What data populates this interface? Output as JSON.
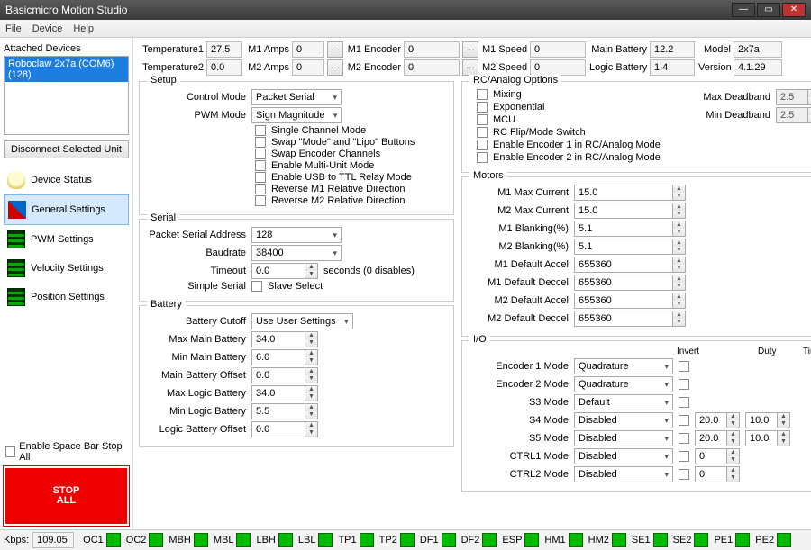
{
  "window": {
    "title": "Basicmicro Motion Studio"
  },
  "menu": {
    "file": "File",
    "device": "Device",
    "help": "Help"
  },
  "sidebar": {
    "attached": "Attached Devices",
    "device": "Roboclaw 2x7a (COM6) (128)",
    "disconnect": "Disconnect Selected Unit",
    "nav": {
      "status": "Device Status",
      "general": "General Settings",
      "pwm": "PWM Settings",
      "velocity": "Velocity Settings",
      "position": "Position Settings"
    },
    "stopchk": "Enable Space Bar Stop All",
    "stop1": "STOP",
    "stop2": "ALL"
  },
  "readouts": {
    "temp1_lbl": "Temperature1",
    "temp1": "27.5",
    "temp2_lbl": "Temperature2",
    "temp2": "0.0",
    "m1a_lbl": "M1 Amps",
    "m1a": "0",
    "m2a_lbl": "M2 Amps",
    "m2a": "0",
    "m1e_lbl": "M1 Encoder",
    "m1e": "0",
    "m2e_lbl": "M2 Encoder",
    "m2e": "0",
    "m1s_lbl": "M1 Speed",
    "m1s": "0",
    "m2s_lbl": "M2 Speed",
    "m2s": "0",
    "main_lbl": "Main Battery",
    "main": "12.2",
    "logic_lbl": "Logic Battery",
    "logic": "1.4",
    "model_lbl": "Model",
    "model": "2x7a",
    "ver_lbl": "Version",
    "ver": "4.1.29"
  },
  "setup": {
    "title": "Setup",
    "ctrlmode_lbl": "Control Mode",
    "ctrlmode": "Packet Serial",
    "pwmmode_lbl": "PWM Mode",
    "pwmmode": "Sign Magnitude",
    "c1": "Single Channel Mode",
    "c2": "Swap \"Mode\" and \"Lipo\" Buttons",
    "c3": "Swap Encoder Channels",
    "c4": "Enable Multi-Unit Mode",
    "c5": "Enable USB to TTL Relay Mode",
    "c6": "Reverse M1 Relative Direction",
    "c7": "Reverse M2 Relative Direction"
  },
  "serial": {
    "title": "Serial",
    "addr_lbl": "Packet Serial Address",
    "addr": "128",
    "baud_lbl": "Baudrate",
    "baud": "38400",
    "timeout_lbl": "Timeout",
    "timeout": "0.0",
    "timeout_suffix": "seconds (0 disables)",
    "simple_lbl": "Simple Serial",
    "slave": "Slave Select"
  },
  "battery": {
    "title": "Battery",
    "cutoff_lbl": "Battery Cutoff",
    "cutoff": "Use User Settings",
    "maxmain_lbl": "Max Main Battery",
    "maxmain": "34.0",
    "minmain_lbl": "Min Main Battery",
    "minmain": "6.0",
    "mainoff_lbl": "Main Battery Offset",
    "mainoff": "0.0",
    "maxlogic_lbl": "Max Logic Battery",
    "maxlogic": "34.0",
    "minlogic_lbl": "Min Logic Battery",
    "minlogic": "5.5",
    "logicoff_lbl": "Logic Battery Offset",
    "logicoff": "0.0"
  },
  "rc": {
    "title": "RC/Analog Options",
    "mixing": "Mixing",
    "exp": "Exponential",
    "mcu": "MCU",
    "flip": "RC Flip/Mode Switch",
    "enc1": "Enable Encoder 1 in RC/Analog Mode",
    "enc2": "Enable Encoder 2 in RC/Analog Mode",
    "maxdb_lbl": "Max Deadband",
    "maxdb": "2.5",
    "mindb_lbl": "Min Deadband",
    "mindb": "2.5",
    "pct": "%"
  },
  "motors": {
    "title": "Motors",
    "m1max_lbl": "M1 Max Current",
    "m1max": "15.0",
    "m2max_lbl": "M2 Max Current",
    "m2max": "15.0",
    "m1blank_lbl": "M1 Blanking(%)",
    "m1blank": "5.1",
    "m2blank_lbl": "M2 Blanking(%)",
    "m2blank": "5.1",
    "m1acc_lbl": "M1 Default Accel",
    "m1acc": "655360",
    "m1dec_lbl": "M1 Default Deccel",
    "m1dec": "655360",
    "m2acc_lbl": "M2 Default Accel",
    "m2acc": "655360",
    "m2dec_lbl": "M2 Default Deccel",
    "m2dec": "655360"
  },
  "io": {
    "title": "I/O",
    "invert": "Invert",
    "duty": "Duty",
    "timeout": "Timeout",
    "enc1_lbl": "Encoder 1 Mode",
    "enc1": "Quadrature",
    "enc2_lbl": "Encoder 2 Mode",
    "enc2": "Quadrature",
    "s3_lbl": "S3 Mode",
    "s3": "Default",
    "s4_lbl": "S4 Mode",
    "s4": "Disabled",
    "s4_duty": "20.0",
    "s4_timeout": "10.0",
    "s5_lbl": "S5 Mode",
    "s5": "Disabled",
    "s5_duty": "20.0",
    "s5_timeout": "10.0",
    "c1_lbl": "CTRL1 Mode",
    "c1": "Disabled",
    "c1_duty": "0",
    "c2_lbl": "CTRL2 Mode",
    "c2": "Disabled",
    "c2_duty": "0"
  },
  "footer": {
    "kbps_lbl": "Kbps:",
    "kbps": "109.05",
    "items": [
      "OC1",
      "OC2",
      "MBH",
      "MBL",
      "LBH",
      "LBL",
      "TP1",
      "TP2",
      "DF1",
      "DF2",
      "ESP",
      "HM1",
      "HM2",
      "SE1",
      "SE2",
      "PE1",
      "PE2"
    ]
  }
}
